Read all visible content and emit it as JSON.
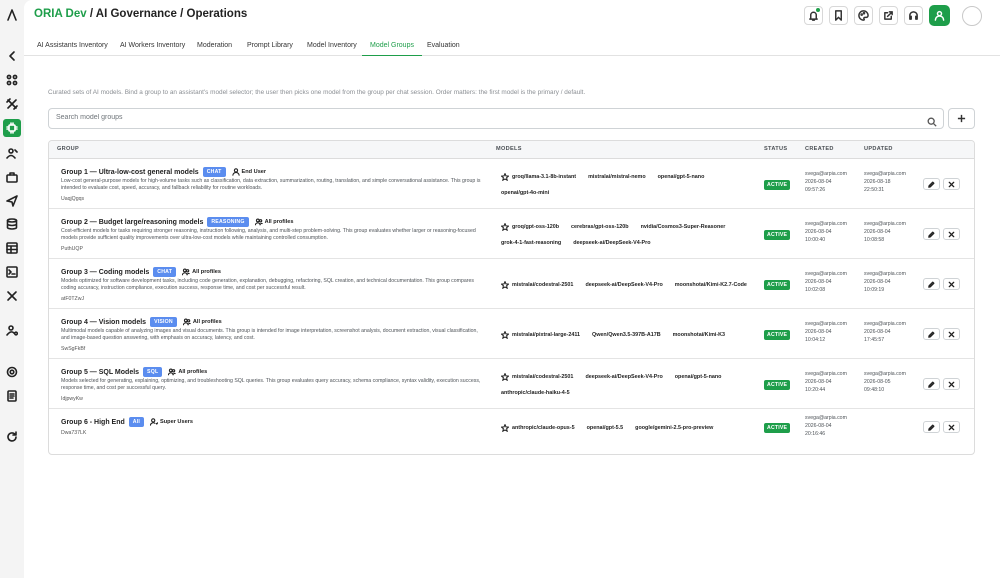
{
  "header": {
    "brand": "ORIA Dev",
    "breadcrumb": " / AI Governance / Operations"
  },
  "tabs": [
    {
      "label": "AI Assistants Inventory"
    },
    {
      "label": "AI Workers Inventory"
    },
    {
      "label": "Moderation"
    },
    {
      "label": "Prompt Library"
    },
    {
      "label": "Model Inventory"
    },
    {
      "label": "Model Groups",
      "active": true
    },
    {
      "label": "Evaluation"
    }
  ],
  "description": "Curated sets of AI models. Bind a group to an assistant's model selector; the user then picks one model from the group per chat session. Order matters: the first model is the primary / default.",
  "search": {
    "placeholder": "Search model groups"
  },
  "columns": {
    "group": "GROUP",
    "models": "MODELS",
    "status": "STATUS",
    "created": "CREATED",
    "updated": "UPDATED"
  },
  "groups": [
    {
      "name": "Group 1 — Ultra-low-cost general models",
      "badge": "CHAT",
      "audience": "End User",
      "description": "Low-cost general-purpose models for high-volume tasks such as classification, data extraction, summarization, routing, translation, and simple conversational assistance. This group is intended to evaluate cost, speed, accuracy, and fallback reliability for routine workloads.",
      "id": "UaqjQgqs",
      "models_line1": [
        "groq/llama-3.1-8b-instant",
        "mistralai/mistral-nemo",
        "openai/gpt-5-nano"
      ],
      "models_line2": [
        "openai/gpt-4o-mini"
      ],
      "status": "ACTIVE",
      "created_by": "svega@arpia.com",
      "created_date": "2026-08-04",
      "created_time": "09:57:26",
      "updated_by": "svega@arpia.com",
      "updated_date": "2026-08-18",
      "updated_time": "22:50:31"
    },
    {
      "name": "Group 2 — Budget large/reasoning models",
      "badge": "REASONING",
      "audience": "All profiles",
      "description": "Cost-efficient models for tasks requiring stronger reasoning, instruction following, analysis, and multi-step problem-solving. This group evaluates whether larger or reasoning-focused models provide sufficient quality improvements over ultra-low-cost models while maintaining controlled consumption.",
      "id": "PuthUQP",
      "models_line1": [
        "groq/gpt-oss-120b",
        "cerebras/gpt-oss-120b",
        "nvidia/Cosmos3-Super-Reasoner"
      ],
      "models_line2": [
        "grok-4-1-fast-reasoning",
        "deepseek-ai/DeepSeek-V4-Pro"
      ],
      "status": "ACTIVE",
      "created_by": "svega@arpia.com",
      "created_date": "2026-08-04",
      "created_time": "10:00:40",
      "updated_by": "svega@arpia.com",
      "updated_date": "2026-08-04",
      "updated_time": "10:08:58"
    },
    {
      "name": "Group 3 — Coding models",
      "badge": "CHAT",
      "audience": "All profiles",
      "description": "Models optimized for software development tasks, including code generation, explanation, debugging, refactoring, SQL creation, and technical documentation. This group compares coding accuracy, instruction compliance, execution success, response time, and cost per successful result.",
      "id": "atF0TZwJ",
      "models_line1": [
        "mistralai/codestral-2501",
        "deepseek-ai/DeepSeek-V4-Pro",
        "moonshotai/Kimi-K2.7-Code"
      ],
      "models_line2": [],
      "status": "ACTIVE",
      "created_by": "svega@arpia.com",
      "created_date": "2026-08-04",
      "created_time": "10:02:08",
      "updated_by": "svega@arpia.com",
      "updated_date": "2026-08-04",
      "updated_time": "10:09:19"
    },
    {
      "name": "Group 4 — Vision models",
      "badge": "VISION",
      "audience": "All profiles",
      "description": "Multimodal models capable of analyzing images and visual documents. This group is intended for image interpretation, screenshot analysis, document extraction, visual classification, and image-based question answering, with emphasis on accuracy, latency, and cost.",
      "id": "SwSgFkBf",
      "models_line1": [
        "mistralai/pixtral-large-2411",
        "Qwen/Qwen3.5-397B-A17B",
        "moonshotai/Kimi-K3"
      ],
      "models_line2": [],
      "status": "ACTIVE",
      "created_by": "svega@arpia.com",
      "created_date": "2026-08-04",
      "created_time": "10:04:12",
      "updated_by": "svega@arpia.com",
      "updated_date": "2026-08-04",
      "updated_time": "17:45:57"
    },
    {
      "name": "Group 5 — SQL Models",
      "badge": "SQL",
      "audience": "All profiles",
      "description": "Models selected for generating, explaining, optimizing, and troubleshooting SQL queries. This group evaluates query accuracy, schema compliance, syntax validity, execution success, response time, and cost per successful query.",
      "id": "IdjpwyKw",
      "models_line1": [
        "mistralai/codestral-2501",
        "deepseek-ai/DeepSeek-V4-Pro",
        "openai/gpt-5-nano"
      ],
      "models_line2": [
        "anthropic/claude-haiku-4-5"
      ],
      "status": "ACTIVE",
      "created_by": "svega@arpia.com",
      "created_date": "2026-08-04",
      "created_time": "10:20:44",
      "updated_by": "svega@arpia.com",
      "updated_date": "2026-08-05",
      "updated_time": "09:48:10"
    },
    {
      "name": "Group 6 - High End",
      "badge": "All",
      "audience": "Super Users",
      "description": "",
      "id": "Dwa737LK",
      "models_line1": [
        "anthropic/claude-opus-5",
        "openai/gpt-5.5",
        "google/gemini-2.5-pro-preview"
      ],
      "models_line2": [],
      "status": "ACTIVE",
      "created_by": "svega@arpia.com",
      "created_date": "2026-08-04",
      "created_time": "20:16:46",
      "updated_by": "",
      "updated_date": "",
      "updated_time": ""
    }
  ]
}
